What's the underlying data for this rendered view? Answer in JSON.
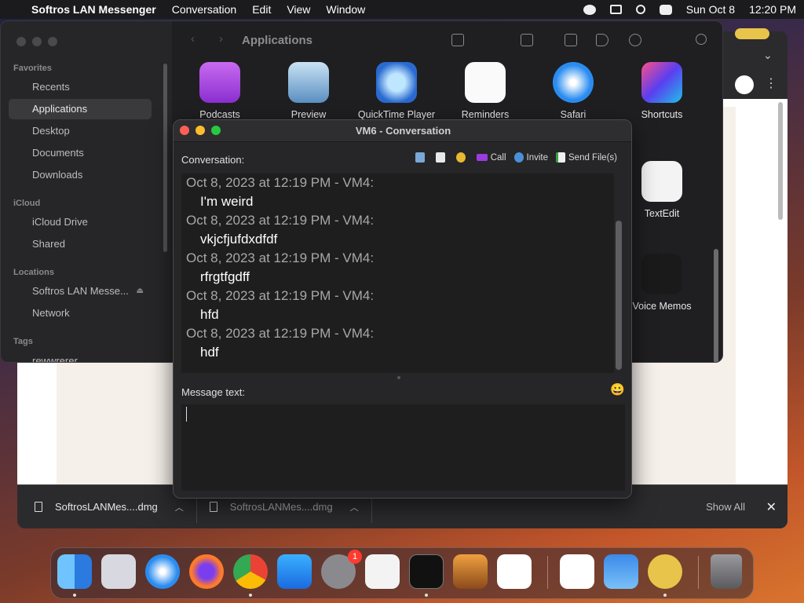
{
  "menubar": {
    "apple_icon": "apple-logo",
    "app_name": "Softros LAN Messenger",
    "menus": [
      "Conversation",
      "Edit",
      "View",
      "Window"
    ],
    "date": "Sun Oct 8",
    "time": "12:20 PM"
  },
  "browser": {
    "downloads": [
      {
        "name": "SoftrosLANMes....dmg"
      },
      {
        "name": "SoftrosLANMes....dmg"
      }
    ],
    "show_all": "Show All",
    "close": "✕"
  },
  "finder": {
    "title": "Applications",
    "sidebar": {
      "favorites_header": "Favorites",
      "favorites": [
        "Recents",
        "Applications",
        "Desktop",
        "Documents",
        "Downloads"
      ],
      "icloud_header": "iCloud",
      "icloud": [
        "iCloud Drive",
        "Shared"
      ],
      "locations_header": "Locations",
      "locations": [
        "Softros LAN Messe...",
        "Network"
      ],
      "tags_header": "Tags",
      "tags": [
        "rewwrerer"
      ]
    },
    "apps_row1": [
      "Podcasts",
      "Preview",
      "QuickTime Player",
      "Reminders",
      "Safari",
      "Shortcuts"
    ],
    "apps_col": [
      "TextEdit",
      "Voice Memos"
    ]
  },
  "conversation": {
    "title": "VM6 - Conversation",
    "conversation_label": "Conversation:",
    "call_label": "Call",
    "invite_label": "Invite",
    "send_files_label": "Send File(s)",
    "messages": [
      {
        "header": "Oct 8, 2023 at 12:19 PM - VM4:",
        "text": "I'm weird"
      },
      {
        "header": "Oct 8, 2023 at 12:19 PM - VM4:",
        "text": "vkjcfjufdxdfdf"
      },
      {
        "header": "Oct 8, 2023 at 12:19 PM - VM4:",
        "text": "rfrgtfgdff"
      },
      {
        "header": "Oct 8, 2023 at 12:19 PM - VM4:",
        "text": "hfd"
      },
      {
        "header": "Oct 8, 2023 at 12:19 PM - VM4:",
        "text": "hdf"
      }
    ],
    "message_label": "Message text:",
    "message_value": "",
    "emoji": "😀"
  },
  "dock": {
    "apps": [
      "Finder",
      "Launchpad",
      "Safari",
      "Firefox",
      "Chrome",
      "App Store",
      "System Settings",
      "TextEdit",
      "Terminal",
      "GarageBand",
      "Visual Studio Code",
      "Visual Studio",
      "Weather",
      "Softros LAN Messenger",
      "Trash"
    ],
    "settings_badge": "1"
  },
  "colors": {
    "accent_blue": "#0a84ff",
    "traffic_red": "#ff5f57",
    "traffic_yellow": "#febc2e",
    "traffic_green": "#28c840"
  }
}
